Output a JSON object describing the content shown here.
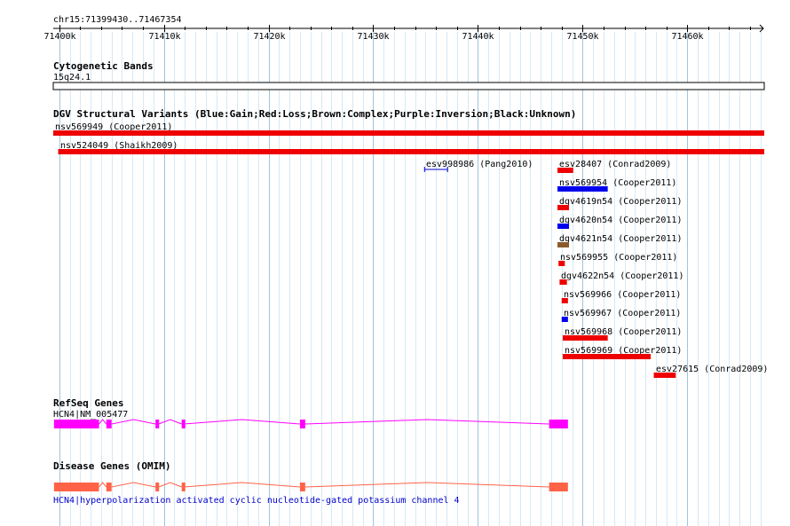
{
  "browser": {
    "location": "chr15:71399430..71467354",
    "view_start": 71399430,
    "view_end": 71467354,
    "ruler_ticks": [
      {
        "pos": 71400000,
        "label": "71400k"
      },
      {
        "pos": 71410000,
        "label": "71410k"
      },
      {
        "pos": 71420000,
        "label": "71420k"
      },
      {
        "pos": 71430000,
        "label": "71430k"
      },
      {
        "pos": 71440000,
        "label": "71440k"
      },
      {
        "pos": 71450000,
        "label": "71450k"
      },
      {
        "pos": 71460000,
        "label": "71460k"
      }
    ],
    "grid_step_bp": 1000
  },
  "tracks": {
    "cytoband": {
      "title": "Cytogenetic Bands",
      "band_label": "15q24.1"
    },
    "dgv": {
      "title": "DGV Structural Variants (Blue:Gain;Red:Loss;Brown:Complex;Purple:Inversion;Black:Unknown)",
      "colors": {
        "gain": "#0000ee",
        "loss": "#ee0000",
        "complex": "#8b5a2b",
        "inversion": "#800080",
        "unknown": "#000000"
      },
      "features": [
        {
          "label": "nsv569949 (Cooper2011)",
          "start": 71399430,
          "end": 71467354,
          "type": "loss",
          "style": "bar"
        },
        {
          "label": "nsv524049 (Shaikh2009)",
          "start": 71399900,
          "end": 71467354,
          "type": "loss",
          "style": "bar"
        },
        {
          "label": "esv998986 (Pang2010)",
          "start": 71434900,
          "end": 71437100,
          "type": "inversion",
          "style": "bracket"
        },
        {
          "label": "esv28407 (Conrad2009)",
          "start": 71447600,
          "end": 71449100,
          "type": "loss",
          "style": "bar"
        },
        {
          "label": "nsv569954 (Cooper2011)",
          "start": 71447600,
          "end": 71452400,
          "type": "gain",
          "style": "bar"
        },
        {
          "label": "dgv4619n54 (Cooper2011)",
          "start": 71447600,
          "end": 71448700,
          "type": "loss",
          "style": "bar"
        },
        {
          "label": "dgv4620n54 (Cooper2011)",
          "start": 71447600,
          "end": 71448700,
          "type": "gain",
          "style": "bar"
        },
        {
          "label": "dgv4621n54 (Cooper2011)",
          "start": 71447600,
          "end": 71448700,
          "type": "complex",
          "style": "bar"
        },
        {
          "label": "nsv569955 (Cooper2011)",
          "start": 71447700,
          "end": 71448300,
          "type": "loss",
          "style": "bar"
        },
        {
          "label": "dgv4622n54 (Cooper2011)",
          "start": 71447800,
          "end": 71448500,
          "type": "loss",
          "style": "bar"
        },
        {
          "label": "nsv569966 (Cooper2011)",
          "start": 71448000,
          "end": 71448600,
          "type": "loss",
          "style": "bar"
        },
        {
          "label": "nsv569967 (Cooper2011)",
          "start": 71448000,
          "end": 71448600,
          "type": "gain",
          "style": "bar"
        },
        {
          "label": "nsv569968 (Cooper2011)",
          "start": 71448100,
          "end": 71452400,
          "type": "loss",
          "style": "bar"
        },
        {
          "label": "nsv569969 (Cooper2011)",
          "start": 71448100,
          "end": 71456500,
          "type": "loss",
          "style": "bar"
        },
        {
          "label": "esv27615 (Conrad2009)",
          "start": 71456800,
          "end": 71458900,
          "type": "loss",
          "style": "bar"
        }
      ]
    },
    "refseq": {
      "title": "RefSeq Genes",
      "color": "#ff00ff",
      "gene": {
        "label": "HCN4|NM_005477",
        "start": 71399500,
        "end": 71448600,
        "exons": [
          [
            71399500,
            71403800
          ],
          [
            71404500,
            71405000
          ],
          [
            71409200,
            71409500
          ],
          [
            71411700,
            71411900
          ],
          [
            71423000,
            71423500
          ],
          [
            71446800,
            71448600
          ]
        ]
      }
    },
    "omim": {
      "title": "Disease Genes (OMIM)",
      "color": "#ff6347",
      "gene": {
        "label": "HCN4|hyperpolarization activated cyclic nucleotide-gated potassium channel 4",
        "start": 71399500,
        "end": 71448600,
        "exons": [
          [
            71399500,
            71403800
          ],
          [
            71404500,
            71405000
          ],
          [
            71409200,
            71409500
          ],
          [
            71411700,
            71411900
          ],
          [
            71423000,
            71423500
          ],
          [
            71446800,
            71448600
          ]
        ]
      }
    }
  }
}
